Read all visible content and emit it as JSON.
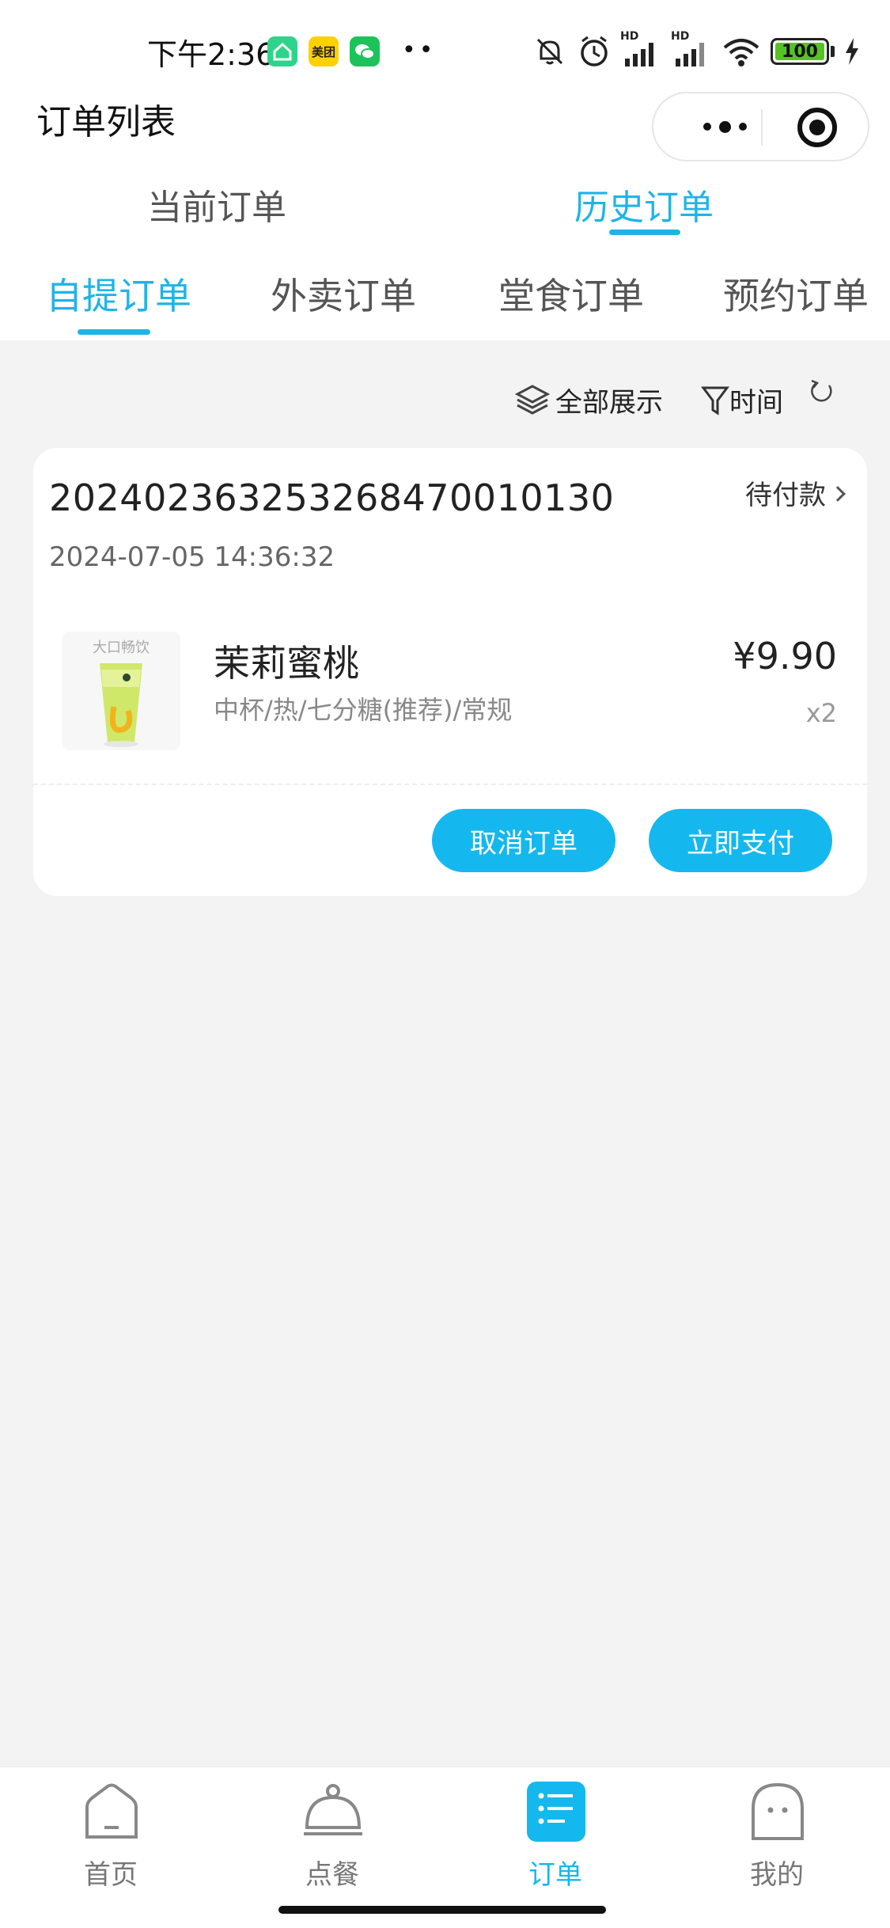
{
  "status_bar": {
    "time": "下午2:36",
    "app_icons": [
      "house-app-icon",
      "meituan-icon",
      "wechat-icon"
    ],
    "meituan_label": "美团",
    "signal_labels": [
      "HD",
      "HD"
    ],
    "battery": "100"
  },
  "nav": {
    "title": "订单列表"
  },
  "main_tabs": [
    {
      "label": "当前订单",
      "active": false
    },
    {
      "label": "历史订单",
      "active": true
    }
  ],
  "sub_tabs": [
    {
      "label": "自提订单",
      "active": true
    },
    {
      "label": "外卖订单",
      "active": false
    },
    {
      "label": "堂食订单",
      "active": false
    },
    {
      "label": "预约订单",
      "active": false
    }
  ],
  "filters": {
    "show_all": "全部展示",
    "time": "时间"
  },
  "order": {
    "number": "20240236325326847​0010130",
    "status": "待付款",
    "date": "2024-07-05 14:36:32",
    "item": {
      "image_label": "大口畅饮",
      "name": "茉莉蜜桃",
      "spec": "中杯/热/七分糖(推荐)/常规",
      "price": "¥9.90",
      "qty": "x2"
    },
    "buttons": {
      "cancel": "取消订单",
      "pay": "立即支付"
    }
  },
  "tab_bar": [
    {
      "label": "首页",
      "icon": "home-icon",
      "active": false
    },
    {
      "label": "点餐",
      "icon": "cloche-icon",
      "active": false
    },
    {
      "label": "订单",
      "icon": "order-list-icon",
      "active": true
    },
    {
      "label": "我的",
      "icon": "ghost-profile-icon",
      "active": false
    }
  ],
  "colors": {
    "accent": "#14b8ee",
    "background": "#f3f3f3",
    "card": "#ffffff"
  }
}
